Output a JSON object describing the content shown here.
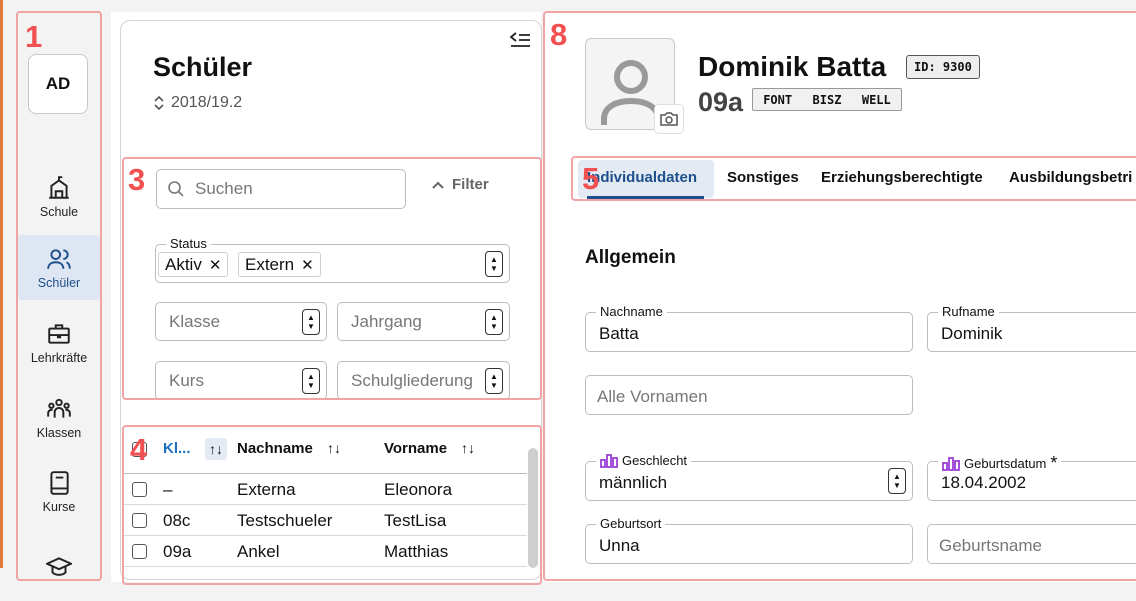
{
  "annotations": [
    "1",
    "3",
    "4",
    "5",
    "8"
  ],
  "nav": {
    "avatar": "AD",
    "items": [
      {
        "label": "Schule",
        "icon": "school-icon"
      },
      {
        "label": "Schüler",
        "icon": "students-icon",
        "active": true
      },
      {
        "label": "Lehrkräfte",
        "icon": "briefcase-icon"
      },
      {
        "label": "Klassen",
        "icon": "group-icon"
      },
      {
        "label": "Kurse",
        "icon": "book-icon"
      },
      {
        "label": "",
        "icon": "graduation-cap-icon"
      }
    ]
  },
  "list": {
    "title": "Schüler",
    "schoolyear": "2018/19.2",
    "search_placeholder": "Suchen",
    "filter_label": "Filter",
    "status_label": "Status",
    "status_chips": [
      "Aktiv",
      "Extern"
    ],
    "klasse_placeholder": "Klasse",
    "jahrgang_placeholder": "Jahrgang",
    "kurs_placeholder": "Kurs",
    "schulgliederung_placeholder": "Schulgliederung",
    "columns": {
      "klasse": "Kl...",
      "nachname": "Nachname",
      "vorname": "Vorname"
    },
    "rows": [
      {
        "klasse": "–",
        "nachname": "Externa",
        "vorname": "Eleonora"
      },
      {
        "klasse": "08c",
        "nachname": "Testschueler",
        "vorname": "TestLisa"
      },
      {
        "klasse": "09a",
        "nachname": "Ankel",
        "vorname": "Matthias"
      }
    ]
  },
  "detail": {
    "name": "Dominik Batta",
    "id_badge": "ID: 9300",
    "klasse": "09a",
    "tags": [
      "FONT",
      "BISZ",
      "WELL"
    ],
    "tabs": [
      "Individualdaten",
      "Sonstiges",
      "Erziehungsberechtigte",
      "Ausbildungsbetri"
    ],
    "section": "Allgemein",
    "fields": {
      "nachname": {
        "label": "Nachname",
        "value": "Batta"
      },
      "rufname": {
        "label": "Rufname",
        "value": "Dominik"
      },
      "vornamen": {
        "placeholder": "Alle Vornamen"
      },
      "geschlecht": {
        "label": "Geschlecht",
        "value": "männlich"
      },
      "geburtsdatum": {
        "label": "Geburtsdatum",
        "required": "*",
        "value": "18.04.2002"
      },
      "geburtsort": {
        "label": "Geburtsort",
        "value": "Unna"
      },
      "geburtsname": {
        "placeholder": "Geburtsname"
      }
    }
  },
  "colors": {
    "accent": "#1d4f8c",
    "highlight": "#f05050",
    "stat_icon": "#9b3fd6"
  }
}
